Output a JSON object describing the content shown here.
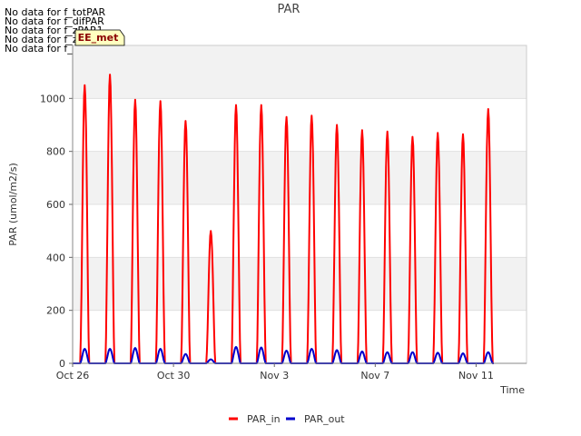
{
  "messages": [
    "No data for f_totPAR",
    "No data for f_difPAR",
    "No data for f_zPAR1",
    "No data for f_zPAR2",
    "No data for f_zPAR3"
  ],
  "badge": {
    "label": "EE_met",
    "bg": "#ffffc0",
    "fg": "#8b0000"
  },
  "chart_data": {
    "type": "line",
    "title": "PAR",
    "xlabel": "Time",
    "ylabel": "PAR (umol/m2/s)",
    "xlim": [
      "2023-10-26",
      "2023-11-13"
    ],
    "ylim": [
      0,
      1200
    ],
    "yticks": [
      0,
      200,
      400,
      600,
      800,
      1000
    ],
    "xticks": [
      {
        "date": "2023-10-26",
        "label": "Oct 26"
      },
      {
        "date": "2023-10-30",
        "label": "Oct 30"
      },
      {
        "date": "2023-11-03",
        "label": "Nov 3"
      },
      {
        "date": "2023-11-07",
        "label": "Nov 7"
      },
      {
        "date": "2023-11-11",
        "label": "Nov 11"
      }
    ],
    "grid": true,
    "legend": "bottom-center",
    "series": [
      {
        "name": "PAR_in",
        "color": "#ff0000",
        "daily_peaks": [
          {
            "date": "2023-10-26",
            "peak": 1050
          },
          {
            "date": "2023-10-27",
            "peak": 1090
          },
          {
            "date": "2023-10-28",
            "peak": 995
          },
          {
            "date": "2023-10-29",
            "peak": 990
          },
          {
            "date": "2023-10-30",
            "peak": 915
          },
          {
            "date": "2023-10-31",
            "peak": 500
          },
          {
            "date": "2023-11-01",
            "peak": 975
          },
          {
            "date": "2023-11-02",
            "peak": 975
          },
          {
            "date": "2023-11-03",
            "peak": 930
          },
          {
            "date": "2023-11-04",
            "peak": 935
          },
          {
            "date": "2023-11-05",
            "peak": 900
          },
          {
            "date": "2023-11-06",
            "peak": 880
          },
          {
            "date": "2023-11-07",
            "peak": 875
          },
          {
            "date": "2023-11-08",
            "peak": 855
          },
          {
            "date": "2023-11-09",
            "peak": 870
          },
          {
            "date": "2023-11-10",
            "peak": 865
          },
          {
            "date": "2023-11-11",
            "peak": 960
          }
        ]
      },
      {
        "name": "PAR_out",
        "color": "#0000cc",
        "daily_peaks": [
          {
            "date": "2023-10-26",
            "peak": 55
          },
          {
            "date": "2023-10-27",
            "peak": 55
          },
          {
            "date": "2023-10-28",
            "peak": 58
          },
          {
            "date": "2023-10-29",
            "peak": 55
          },
          {
            "date": "2023-10-30",
            "peak": 35
          },
          {
            "date": "2023-10-31",
            "peak": 15
          },
          {
            "date": "2023-11-01",
            "peak": 62
          },
          {
            "date": "2023-11-02",
            "peak": 60
          },
          {
            "date": "2023-11-03",
            "peak": 48
          },
          {
            "date": "2023-11-04",
            "peak": 55
          },
          {
            "date": "2023-11-05",
            "peak": 50
          },
          {
            "date": "2023-11-06",
            "peak": 45
          },
          {
            "date": "2023-11-07",
            "peak": 42
          },
          {
            "date": "2023-11-08",
            "peak": 42
          },
          {
            "date": "2023-11-09",
            "peak": 40
          },
          {
            "date": "2023-11-10",
            "peak": 38
          },
          {
            "date": "2023-11-11",
            "peak": 42
          }
        ]
      }
    ]
  }
}
